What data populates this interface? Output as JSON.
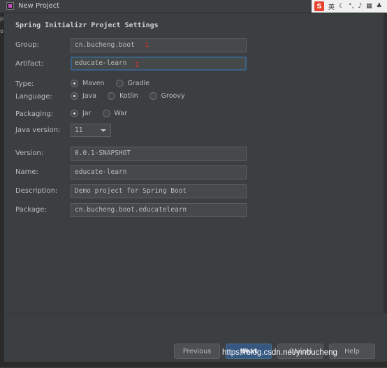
{
  "window": {
    "title": "New Project"
  },
  "tray": {
    "ime_label": "S",
    "lang": "英"
  },
  "heading": "Spring Initializr Project Settings",
  "fields": {
    "group": {
      "label": "Group:",
      "value": "cn.bucheng.boot",
      "annotation": "1"
    },
    "artifact": {
      "label": "Artifact:",
      "value": "educate-learn",
      "annotation": "2"
    },
    "version": {
      "label": "Version:",
      "value": "0.0.1-SNAPSHOT"
    },
    "name": {
      "label": "Name:",
      "value": "educate-learn"
    },
    "description": {
      "label": "Description:",
      "value": "Demo project for Spring Boot"
    },
    "package": {
      "label": "Package:",
      "value": "cn.bucheng.boot.educatelearn"
    }
  },
  "type": {
    "label": "Type:",
    "options": [
      "Maven",
      "Gradle"
    ],
    "selected": "Maven"
  },
  "language": {
    "label": "Language:",
    "options": [
      "Java",
      "Kotlin",
      "Groovy"
    ],
    "selected": "Java"
  },
  "packaging": {
    "label": "Packaging:",
    "options": [
      "Jar",
      "War"
    ],
    "selected": "Jar"
  },
  "java_version": {
    "label": "Java version:",
    "value": "11"
  },
  "buttons": {
    "previous": "Previous",
    "next": "Next",
    "cancel": "Cancel",
    "help": "Help"
  },
  "watermark": "https://blog.csdn.net/yinbucheng",
  "colors": {
    "accent": "#365880",
    "focus": "#3d6185",
    "annotation": "#e03030",
    "background": "#3c3f41"
  }
}
